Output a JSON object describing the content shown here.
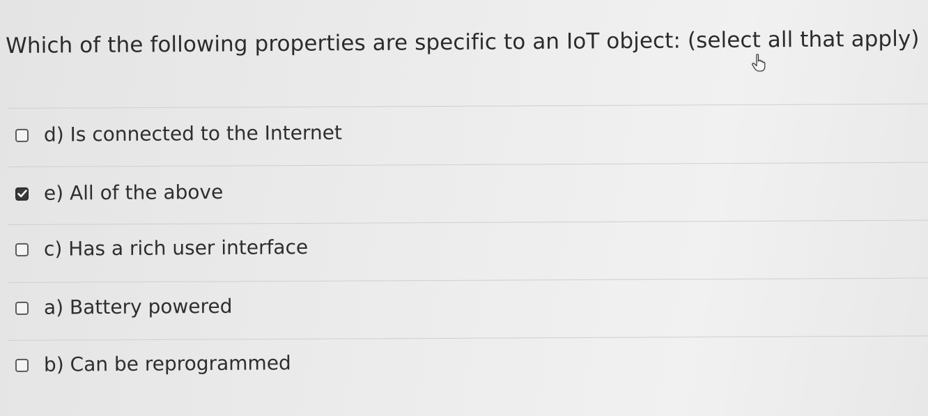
{
  "question": {
    "text": "Which of the following properties are specific to an IoT object: (select all that apply)"
  },
  "options": [
    {
      "label": "d) Is connected to the Internet",
      "checked": false
    },
    {
      "label": "e) All of the above",
      "checked": true
    },
    {
      "label": "c) Has a rich user interface",
      "checked": false
    },
    {
      "label": "a) Battery powered",
      "checked": false
    },
    {
      "label": "b) Can be reprogrammed",
      "checked": false
    }
  ],
  "icons": {
    "cursor": "hand-pointer-icon",
    "check": "check-mark-icon"
  },
  "colors": {
    "background": "#e9e9e9",
    "text": "#2b2b2b",
    "checkbox_checked": "#3a3a3a",
    "divider": "#cfcfcf"
  }
}
